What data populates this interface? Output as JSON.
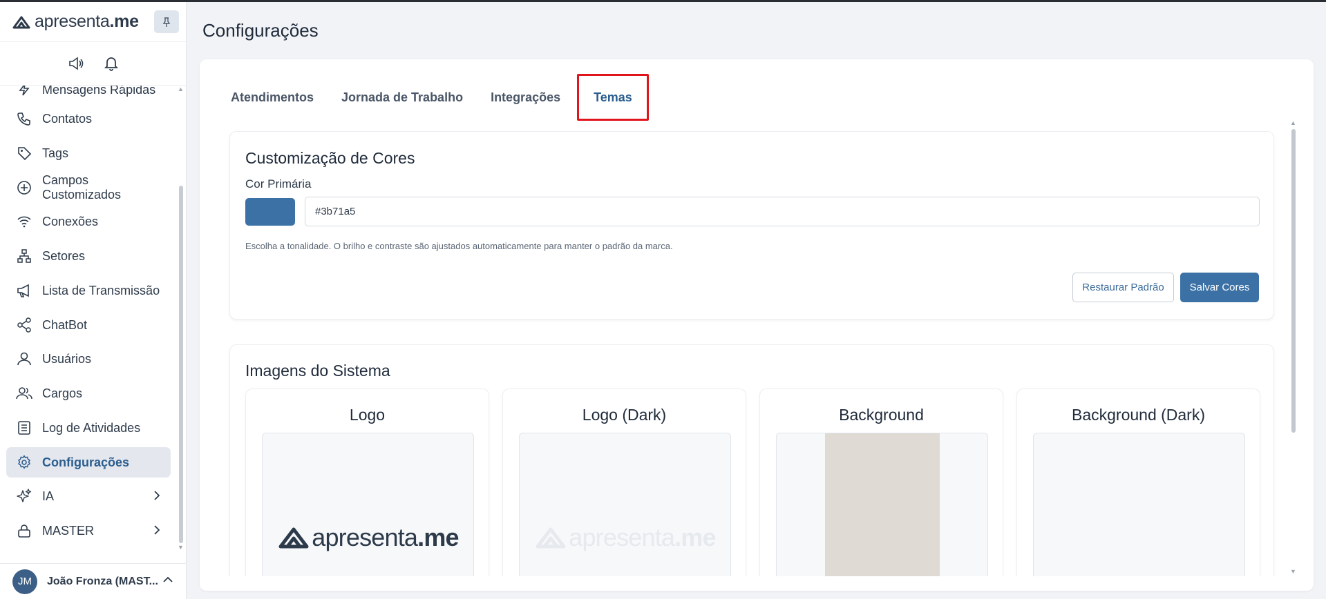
{
  "brand": {
    "name_regular": "apresenta",
    "name_bold": ".me"
  },
  "sidebar": {
    "top_icons": [
      "megaphone-icon",
      "bell-icon"
    ],
    "items": [
      {
        "label": "Mensagens Rápidas",
        "icon": "bolt-icon"
      },
      {
        "label": "Contatos",
        "icon": "phone-icon"
      },
      {
        "label": "Tags",
        "icon": "tag-icon"
      },
      {
        "label": "Campos Customizados",
        "icon": "plus-circle-icon"
      },
      {
        "label": "Conexões",
        "icon": "wifi-icon"
      },
      {
        "label": "Setores",
        "icon": "sitemap-icon"
      },
      {
        "label": "Lista de Transmissão",
        "icon": "megaphone-icon"
      },
      {
        "label": "ChatBot",
        "icon": "share-icon"
      },
      {
        "label": "Usuários",
        "icon": "user-icon"
      },
      {
        "label": "Cargos",
        "icon": "users-icon"
      },
      {
        "label": "Log de Atividades",
        "icon": "list-icon"
      },
      {
        "label": "Configurações",
        "icon": "gear-icon",
        "active": true
      },
      {
        "label": "IA",
        "icon": "sparkles-icon",
        "has_submenu": true
      },
      {
        "label": "MASTER",
        "icon": "lock-icon",
        "has_submenu": true
      }
    ],
    "user": {
      "initials": "JM",
      "name": "João Fronza (MAST..."
    }
  },
  "page": {
    "title": "Configurações"
  },
  "tabs": [
    {
      "label": "Atendimentos",
      "active": false
    },
    {
      "label": "Jornada de Trabalho",
      "active": false
    },
    {
      "label": "Integrações",
      "active": false
    },
    {
      "label": "Temas",
      "active": true
    }
  ],
  "colors_section": {
    "title": "Customização de Cores",
    "primary_label": "Cor Primária",
    "primary_value": "#3b71a5",
    "help_text": "Escolha a tonalidade. O brilho e contraste são ajustados automaticamente para manter o padrão da marca.",
    "restore_button": "Restaurar Padrão",
    "save_button": "Salvar Cores"
  },
  "images_section": {
    "title": "Imagens do Sistema",
    "cards": [
      {
        "title": "Logo"
      },
      {
        "title": "Logo (Dark)"
      },
      {
        "title": "Background"
      },
      {
        "title": "Background (Dark)"
      }
    ]
  },
  "colors": {
    "accent": "#3b71a5",
    "highlight_border": "#e0151c",
    "active_nav_bg": "#e4e8ee"
  }
}
